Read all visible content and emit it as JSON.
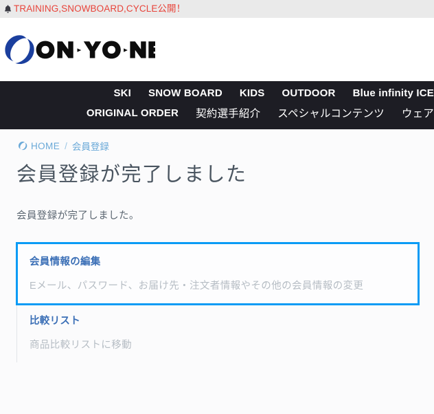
{
  "announcement": {
    "icon": "bell-icon",
    "text": "TRAINING,SNOWBOARD,CYCLE公開！",
    "color": "#e8443a",
    "background": "#eaeaea"
  },
  "brand": {
    "logo_text": "ON·YO·NE",
    "logo_mark": "onyone-o-mark",
    "mark_color": "#1b3f9e",
    "text_color": "#0d0d0d"
  },
  "nav": {
    "background": "#1d1d24",
    "row1": [
      {
        "label": "SKI"
      },
      {
        "label": "SNOW BOARD"
      },
      {
        "label": "KIDS"
      },
      {
        "label": "OUTDOOR"
      },
      {
        "label": "Blue infinity ICE"
      }
    ],
    "row2": [
      {
        "label": "ORIGINAL ORDER"
      },
      {
        "label": "契約選手紹介"
      },
      {
        "label": "スペシャルコンテンツ"
      },
      {
        "label": "ウェア"
      }
    ]
  },
  "breadcrumb": {
    "home": "HOME",
    "separator": "/",
    "current": "会員登録"
  },
  "page": {
    "title": "会員登録が完了しました",
    "lead": "会員登録が完了しました。"
  },
  "links": [
    {
      "title": "会員情報の編集",
      "description": "Eメール、パスワード、お届け先・注文者情報やその他の会員情報の変更",
      "focused": true,
      "focus_color": "#0a9bf5"
    },
    {
      "title": "比較リスト",
      "description": "商品比較リストに移動",
      "focused": false
    }
  ]
}
